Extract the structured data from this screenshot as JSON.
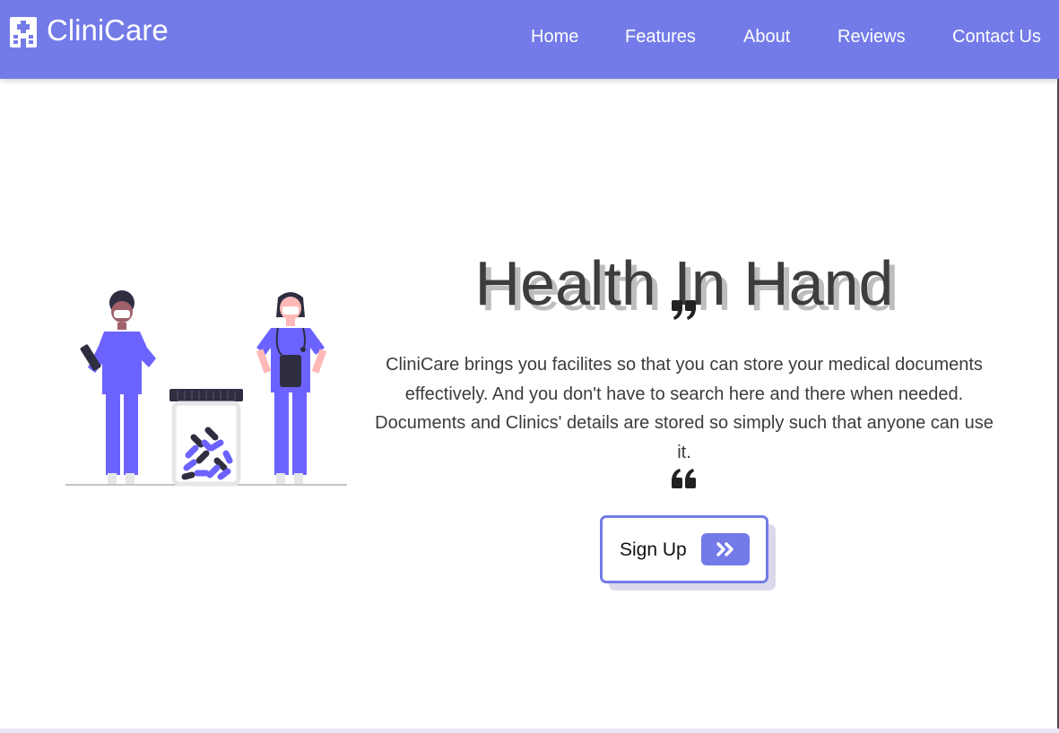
{
  "brand": {
    "name": "CliniCare",
    "icon": "hospital-icon"
  },
  "nav": {
    "items": [
      {
        "label": "Home"
      },
      {
        "label": "Features"
      },
      {
        "label": "About"
      },
      {
        "label": "Reviews"
      },
      {
        "label": "Contact Us"
      }
    ]
  },
  "hero": {
    "title": "Health In Hand",
    "text": "CliniCare brings you facilites so that you can store your medical documents effectively. And you don't have to search here and there when needed. Documents and Clinics' details are stored so simply such that anyone can use it.",
    "illustration": "doctors-with-pill-jar-illustration",
    "quote_icons": [
      "quote-right-icon",
      "quote-left-icon"
    ],
    "signup": {
      "label": "Sign Up",
      "icon": "double-chevron-right-icon"
    }
  },
  "colors": {
    "accent": "#737be8",
    "illustration_purple": "#6c63ff",
    "text": "#3c3c3c"
  }
}
